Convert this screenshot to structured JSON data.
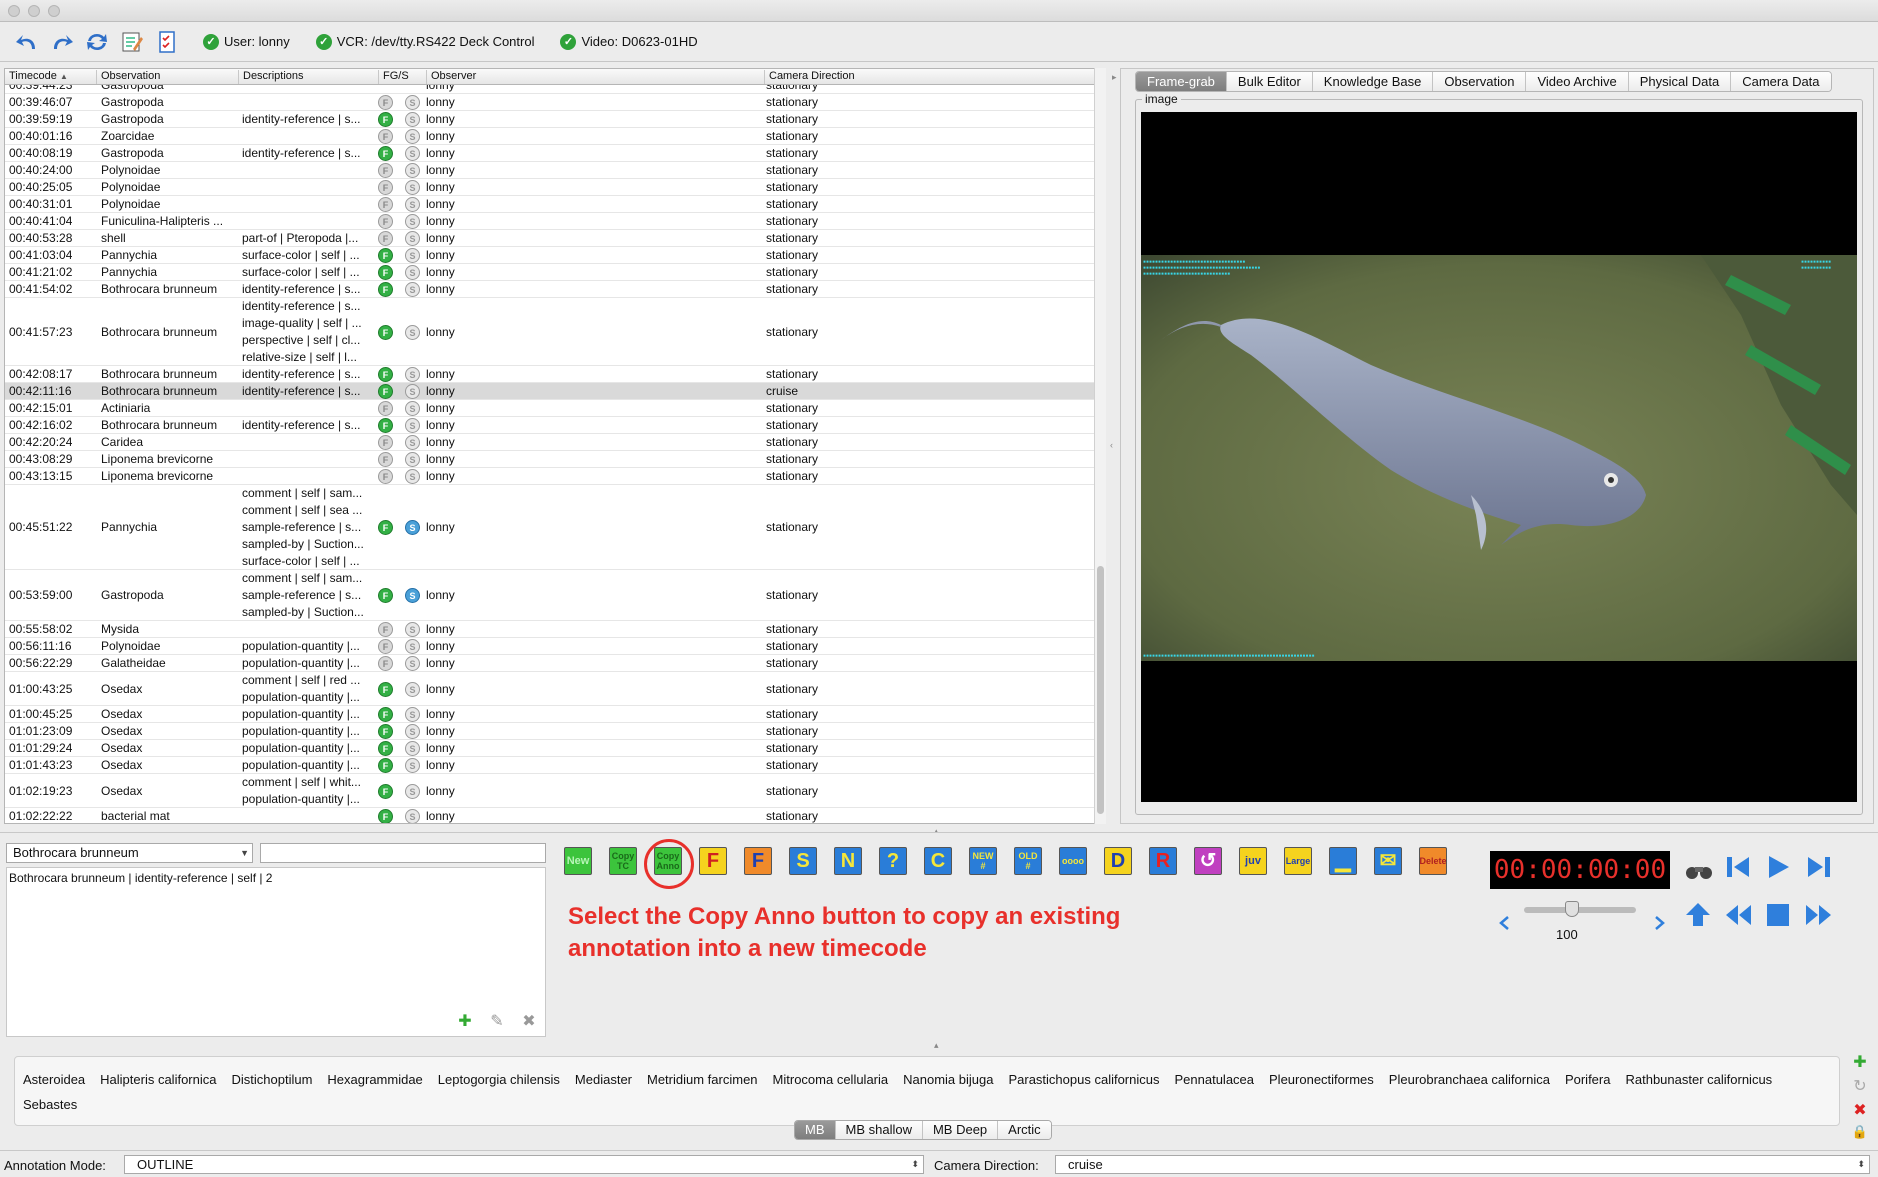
{
  "toolbar": {
    "user_status": "User: lonny",
    "vcr_status": "VCR: /dev/tty.RS422 Deck Control",
    "video_status": "Video: D0623-01HD",
    "icons": [
      "undo-icon",
      "redo-icon",
      "refresh-icon",
      "edit-list-icon",
      "checklist-icon"
    ]
  },
  "table": {
    "columns": [
      "Timecode",
      "Observation",
      "Descriptions",
      "FG/S",
      "Observer",
      "Camera Direction"
    ],
    "partial_top_row": {
      "timecode": "00:39:44:23",
      "observation": "Gastropoda",
      "observer": "lonny",
      "direction": "stationary"
    },
    "rows": [
      {
        "timecode": "00:39:46:07",
        "observation": "Gastropoda",
        "desc": [],
        "fg": "grey",
        "s": "grey",
        "observer": "lonny",
        "direction": "stationary"
      },
      {
        "timecode": "00:39:59:19",
        "observation": "Gastropoda",
        "desc": [
          "identity-reference | s..."
        ],
        "fg": "green",
        "s": "grey",
        "observer": "lonny",
        "direction": "stationary"
      },
      {
        "timecode": "00:40:01:16",
        "observation": "Zoarcidae",
        "desc": [],
        "fg": "grey",
        "s": "grey",
        "observer": "lonny",
        "direction": "stationary"
      },
      {
        "timecode": "00:40:08:19",
        "observation": "Gastropoda",
        "desc": [
          "identity-reference | s..."
        ],
        "fg": "green",
        "s": "grey",
        "observer": "lonny",
        "direction": "stationary"
      },
      {
        "timecode": "00:40:24:00",
        "observation": "Polynoidae",
        "desc": [],
        "fg": "grey",
        "s": "grey",
        "observer": "lonny",
        "direction": "stationary"
      },
      {
        "timecode": "00:40:25:05",
        "observation": "Polynoidae",
        "desc": [],
        "fg": "grey",
        "s": "grey",
        "observer": "lonny",
        "direction": "stationary"
      },
      {
        "timecode": "00:40:31:01",
        "observation": "Polynoidae",
        "desc": [],
        "fg": "grey",
        "s": "grey",
        "observer": "lonny",
        "direction": "stationary"
      },
      {
        "timecode": "00:40:41:04",
        "observation": "Funiculina-Halipteris ...",
        "desc": [],
        "fg": "grey",
        "s": "grey",
        "observer": "lonny",
        "direction": "stationary"
      },
      {
        "timecode": "00:40:53:28",
        "observation": "shell",
        "desc": [
          "part-of | Pteropoda |..."
        ],
        "fg": "grey",
        "s": "grey",
        "observer": "lonny",
        "direction": "stationary"
      },
      {
        "timecode": "00:41:03:04",
        "observation": "Pannychia",
        "desc": [
          "surface-color | self | ..."
        ],
        "fg": "green",
        "s": "grey",
        "observer": "lonny",
        "direction": "stationary"
      },
      {
        "timecode": "00:41:21:02",
        "observation": "Pannychia",
        "desc": [
          "surface-color | self | ..."
        ],
        "fg": "green",
        "s": "grey",
        "observer": "lonny",
        "direction": "stationary"
      },
      {
        "timecode": "00:41:54:02",
        "observation": "Bothrocara brunneum",
        "desc": [
          "identity-reference | s..."
        ],
        "fg": "green",
        "s": "grey",
        "observer": "lonny",
        "direction": "stationary"
      },
      {
        "timecode": "00:41:57:23",
        "observation": "Bothrocara brunneum",
        "desc": [
          "identity-reference | s...",
          "image-quality | self | ...",
          "perspective | self | cl...",
          "relative-size | self | l..."
        ],
        "fg": "green",
        "s": "grey",
        "observer": "lonny",
        "direction": "stationary"
      },
      {
        "timecode": "00:42:08:17",
        "observation": "Bothrocara brunneum",
        "desc": [
          "identity-reference | s..."
        ],
        "fg": "green",
        "s": "grey",
        "observer": "lonny",
        "direction": "stationary"
      },
      {
        "timecode": "00:42:11:16",
        "observation": "Bothrocara brunneum",
        "desc": [
          "identity-reference | s..."
        ],
        "fg": "green",
        "s": "grey",
        "observer": "lonny",
        "direction": "cruise",
        "selected": true
      },
      {
        "timecode": "00:42:15:01",
        "observation": "Actiniaria",
        "desc": [],
        "fg": "grey",
        "s": "grey",
        "observer": "lonny",
        "direction": "stationary"
      },
      {
        "timecode": "00:42:16:02",
        "observation": "Bothrocara brunneum",
        "desc": [
          "identity-reference | s..."
        ],
        "fg": "green",
        "s": "grey",
        "observer": "lonny",
        "direction": "stationary"
      },
      {
        "timecode": "00:42:20:24",
        "observation": "Caridea",
        "desc": [],
        "fg": "grey",
        "s": "grey",
        "observer": "lonny",
        "direction": "stationary"
      },
      {
        "timecode": "00:43:08:29",
        "observation": "Liponema brevicorne",
        "desc": [],
        "fg": "grey",
        "s": "grey",
        "observer": "lonny",
        "direction": "stationary"
      },
      {
        "timecode": "00:43:13:15",
        "observation": "Liponema brevicorne",
        "desc": [],
        "fg": "grey",
        "s": "grey",
        "observer": "lonny",
        "direction": "stationary"
      },
      {
        "timecode": "00:45:51:22",
        "observation": "Pannychia",
        "desc": [
          "comment | self | sam...",
          "comment | self | sea ...",
          "sample-reference | s...",
          "sampled-by | Suction...",
          "surface-color | self | ..."
        ],
        "fg": "green",
        "s": "blue",
        "observer": "lonny",
        "direction": "stationary"
      },
      {
        "timecode": "00:53:59:00",
        "observation": "Gastropoda",
        "desc": [
          "comment | self | sam...",
          "sample-reference | s...",
          "sampled-by | Suction..."
        ],
        "fg": "green",
        "s": "blue",
        "observer": "lonny",
        "direction": "stationary"
      },
      {
        "timecode": "00:55:58:02",
        "observation": "Mysida",
        "desc": [],
        "fg": "grey",
        "s": "grey",
        "observer": "lonny",
        "direction": "stationary"
      },
      {
        "timecode": "00:56:11:16",
        "observation": "Polynoidae",
        "desc": [
          "population-quantity |..."
        ],
        "fg": "grey",
        "s": "grey",
        "observer": "lonny",
        "direction": "stationary"
      },
      {
        "timecode": "00:56:22:29",
        "observation": "Galatheidae",
        "desc": [
          "population-quantity |..."
        ],
        "fg": "grey",
        "s": "grey",
        "observer": "lonny",
        "direction": "stationary"
      },
      {
        "timecode": "01:00:43:25",
        "observation": "Osedax",
        "desc": [
          "comment | self | red ...",
          "population-quantity |..."
        ],
        "fg": "green",
        "s": "grey",
        "observer": "lonny",
        "direction": "stationary"
      },
      {
        "timecode": "01:00:45:25",
        "observation": "Osedax",
        "desc": [
          "population-quantity |..."
        ],
        "fg": "green",
        "s": "grey",
        "observer": "lonny",
        "direction": "stationary"
      },
      {
        "timecode": "01:01:23:09",
        "observation": "Osedax",
        "desc": [
          "population-quantity |..."
        ],
        "fg": "green",
        "s": "grey",
        "observer": "lonny",
        "direction": "stationary"
      },
      {
        "timecode": "01:01:29:24",
        "observation": "Osedax",
        "desc": [
          "population-quantity |..."
        ],
        "fg": "green",
        "s": "grey",
        "observer": "lonny",
        "direction": "stationary"
      },
      {
        "timecode": "01:01:43:23",
        "observation": "Osedax",
        "desc": [
          "population-quantity |..."
        ],
        "fg": "green",
        "s": "grey",
        "observer": "lonny",
        "direction": "stationary"
      },
      {
        "timecode": "01:02:19:23",
        "observation": "Osedax",
        "desc": [
          "comment | self | whit...",
          "population-quantity |..."
        ],
        "fg": "green",
        "s": "grey",
        "observer": "lonny",
        "direction": "stationary"
      },
      {
        "timecode": "01:02:22:22",
        "observation": "bacterial mat",
        "desc": [],
        "fg": "green",
        "s": "grey",
        "observer": "lonny",
        "direction": "stationary"
      }
    ]
  },
  "tabs": [
    "Frame-grab",
    "Bulk Editor",
    "Knowledge Base",
    "Observation",
    "Video Archive",
    "Physical Data",
    "Camera Data"
  ],
  "active_tab": "Frame-grab",
  "image_panel": {
    "label": "image"
  },
  "editor": {
    "concept_value": "Bothrocara brunneum",
    "association": "Bothrocara brunneum | identity-reference | self | 2",
    "buttons": [
      {
        "label": "New",
        "name": "new-button",
        "bg": "#3cc43c",
        "fg": "#b8f5b8"
      },
      {
        "label": "Copy TC",
        "name": "copy-tc-button",
        "bg": "#3cc43c",
        "fg": "#1a6a1a"
      },
      {
        "label": "Copy Anno",
        "name": "copy-anno-button",
        "bg": "#3cc43c",
        "fg": "#1a6a1a"
      },
      {
        "label": "F",
        "name": "f-button",
        "bg": "#f5d31e",
        "fg": "#d02020"
      },
      {
        "label": "F",
        "name": "f-delete-button",
        "bg": "#f08a2a",
        "fg": "#2040b0"
      },
      {
        "label": "S",
        "name": "s-button",
        "bg": "#2a7dd8",
        "fg": "#f5e63a"
      },
      {
        "label": "N",
        "name": "n-button",
        "bg": "#2a7dd8",
        "fg": "#f5e63a"
      },
      {
        "label": "?",
        "name": "question-button",
        "bg": "#2a7dd8",
        "fg": "#f5e63a"
      },
      {
        "label": "C",
        "name": "c-button",
        "bg": "#2a7dd8",
        "fg": "#f5e63a"
      },
      {
        "label": "NEW #",
        "name": "new-number-button",
        "bg": "#2a7dd8",
        "fg": "#f5e63a"
      },
      {
        "label": "OLD #",
        "name": "old-number-button",
        "bg": "#2a7dd8",
        "fg": "#f5e63a"
      },
      {
        "label": "oooo",
        "name": "bubbles-button",
        "bg": "#2a7dd8",
        "fg": "#f5e63a"
      },
      {
        "label": "D",
        "name": "d-button",
        "bg": "#f5d31e",
        "fg": "#2040b0"
      },
      {
        "label": "R",
        "name": "r-button",
        "bg": "#2a7dd8",
        "fg": "#e82020"
      },
      {
        "label": "↺",
        "name": "magnet-button",
        "bg": "#c040c0",
        "fg": "#fff"
      },
      {
        "label": "juv",
        "name": "juv-button",
        "bg": "#f5d31e",
        "fg": "#2040b0"
      },
      {
        "label": "Large",
        "name": "large-button",
        "bg": "#f5d31e",
        "fg": "#2040b0"
      },
      {
        "label": "▁",
        "name": "bottom-button",
        "bg": "#2a7dd8",
        "fg": "#f5e63a"
      },
      {
        "label": "✉",
        "name": "message-button",
        "bg": "#2a7dd8",
        "fg": "#f5e63a"
      },
      {
        "label": "Delete",
        "name": "delete-button",
        "bg": "#f08a2a",
        "fg": "#b02020"
      }
    ],
    "instruction": "Select the Copy Anno button to copy an existing annotation into a new timecode"
  },
  "video_control": {
    "timecode": "00:00:00:00",
    "speed": "100"
  },
  "quick_concepts": [
    "Asteroidea",
    "Halipteris californica",
    "Distichoptilum",
    "Hexagrammidae",
    "Leptogorgia chilensis",
    "Mediaster",
    "Metridium farcimen",
    "Mitrocoma cellularia",
    "Nanomia bijuga",
    "Parastichopus californicus",
    "Pennatulacea",
    "Pleuronectiformes",
    "Pleurobranchaea californica",
    "Porifera",
    "Rathbunaster californicus",
    "Sebastes"
  ],
  "quick_tabs": [
    "MB",
    "MB shallow",
    "MB Deep",
    "Arctic"
  ],
  "status_bar": {
    "annotation_mode_label": "Annotation Mode:",
    "annotation_mode": "OUTLINE",
    "camera_direction_label": "Camera Direction:",
    "camera_direction": "cruise"
  }
}
